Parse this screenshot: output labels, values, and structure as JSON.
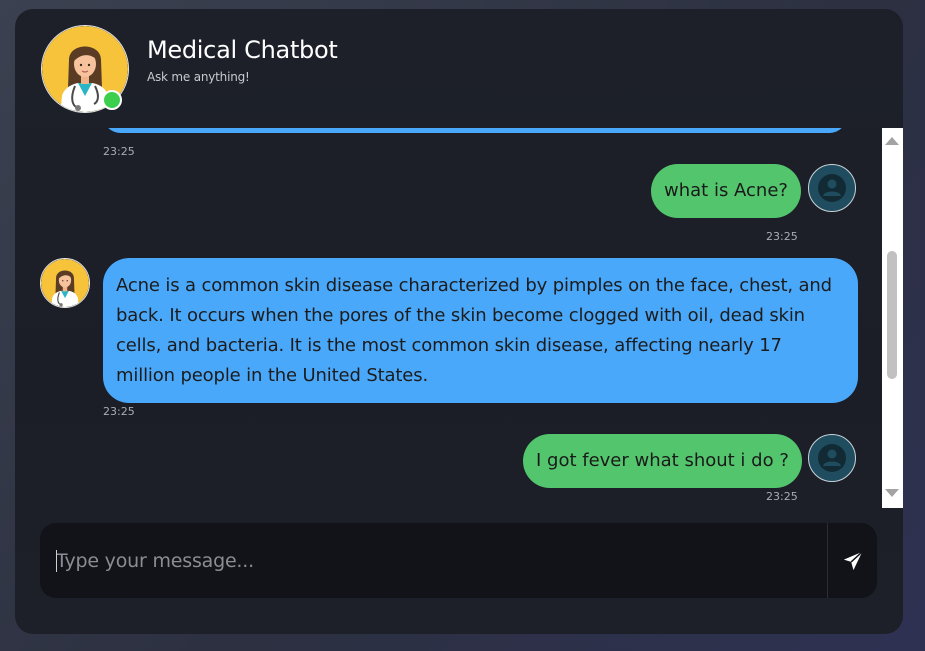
{
  "header": {
    "title": "Medical Chatbot",
    "subtitle": "Ask me anything!",
    "status": "online"
  },
  "messages": [
    {
      "sender": "bot",
      "text": "",
      "time": "23:25",
      "partial": true
    },
    {
      "sender": "user",
      "text": "what is Acne?",
      "time": "23:25"
    },
    {
      "sender": "bot",
      "text": "Acne is a common skin disease characterized by pimples on the face, chest, and back. It occurs when the pores of the skin become clogged with oil, dead skin cells, and bacteria. It is the most common skin disease, affecting nearly 17 million people in the United States.",
      "time": "23:25"
    },
    {
      "sender": "user",
      "text": "I got fever what shout i do ?",
      "time": "23:25"
    }
  ],
  "composer": {
    "placeholder": "Type your message...",
    "value": "",
    "send_icon": "paper-plane-icon"
  },
  "colors": {
    "bot_bubble": "#4aa8fb",
    "user_bubble": "#53c66d",
    "online": "#3ccf4e",
    "card_background": "#1d2029"
  },
  "icons": {
    "bot_avatar": "doctor-avatar-icon",
    "user_avatar": "user-icon",
    "scroll_up": "scroll-up-arrow-icon",
    "scroll_down": "scroll-down-arrow-icon"
  }
}
